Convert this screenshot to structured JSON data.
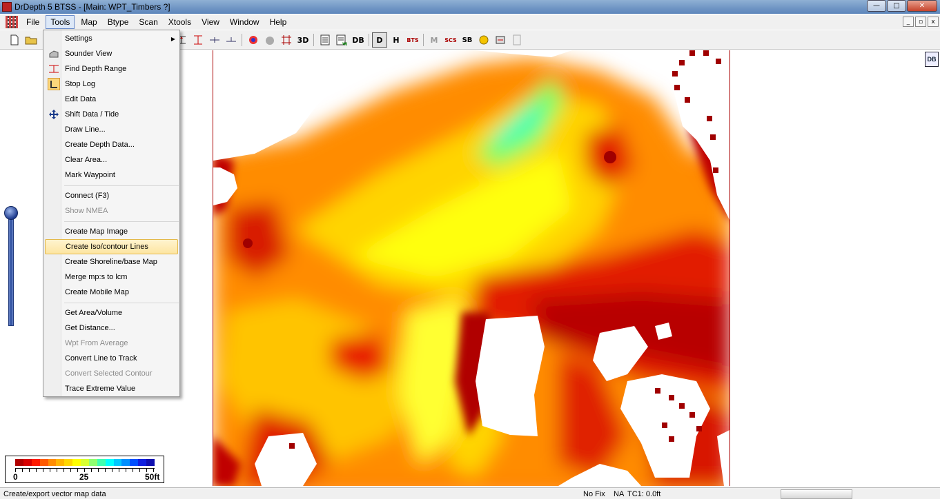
{
  "window": {
    "title": "DrDepth 5 BTSS - [Main: WPT_Timbers ?]",
    "buttons": [
      "—",
      "□",
      "✕"
    ]
  },
  "menubar": {
    "items": [
      "File",
      "Tools",
      "Map",
      "Btype",
      "Scan",
      "Xtools",
      "View",
      "Window",
      "Help"
    ],
    "active": "Tools",
    "mdi_buttons": [
      "_",
      "▫",
      "x"
    ]
  },
  "toolbar": {
    "text_buttons": {
      "three_d": "3D",
      "d_button": "D",
      "h_button": "H",
      "bts": "BTS",
      "m_button": "M",
      "scs": "SCS",
      "sb": "SB",
      "db": "DB"
    }
  },
  "tools_menu": {
    "items": [
      {
        "label": "Settings",
        "icon": "",
        "submenu": true,
        "disabled": false
      },
      {
        "label": "Sounder View",
        "icon": "sounder-icon",
        "disabled": false
      },
      {
        "label": "Find Depth Range",
        "icon": "depth-range-icon",
        "disabled": false
      },
      {
        "label": "Stop Log",
        "icon": "stop-log-icon",
        "disabled": false
      },
      {
        "label": "Edit Data",
        "icon": "",
        "disabled": false
      },
      {
        "label": "Shift Data / Tide",
        "icon": "move-arrows-icon",
        "disabled": false
      },
      {
        "label": "Draw Line...",
        "icon": "",
        "disabled": false
      },
      {
        "label": "Create Depth Data...",
        "icon": "",
        "disabled": false
      },
      {
        "label": "Clear Area...",
        "icon": "",
        "disabled": false
      },
      {
        "label": "Mark Waypoint",
        "icon": "",
        "disabled": false
      },
      {
        "label": "Connect (F3)",
        "icon": "",
        "disabled": false
      },
      {
        "label": "Show NMEA",
        "icon": "",
        "disabled": true
      },
      {
        "label": "Create Map Image",
        "icon": "",
        "disabled": false
      },
      {
        "label": "Create Iso/contour Lines",
        "icon": "",
        "disabled": false,
        "highlighted": true
      },
      {
        "label": "Create Shoreline/base Map",
        "icon": "",
        "disabled": false
      },
      {
        "label": "Merge mp:s to lcm",
        "icon": "",
        "disabled": false
      },
      {
        "label": "Create Mobile Map",
        "icon": "",
        "disabled": false
      },
      {
        "label": "Get Area/Volume",
        "icon": "",
        "disabled": false
      },
      {
        "label": "Get Distance...",
        "icon": "",
        "disabled": false
      },
      {
        "label": "Wpt From Average",
        "icon": "",
        "disabled": true
      },
      {
        "label": "Convert Line to Track",
        "icon": "",
        "disabled": false
      },
      {
        "label": "Convert Selected Contour",
        "icon": "",
        "disabled": true
      },
      {
        "label": "Trace Extreme Value",
        "icon": "",
        "disabled": false
      }
    ]
  },
  "legend": {
    "min_label": "0",
    "mid_label": "25",
    "max_label": "50ft",
    "colors": [
      "#b00000",
      "#d80000",
      "#ff1a00",
      "#ff5a00",
      "#ff8c00",
      "#ffb400",
      "#ffd700",
      "#ffff00",
      "#d8ff30",
      "#90ff70",
      "#40ffb0",
      "#00ffff",
      "#00c8ff",
      "#0090ff",
      "#0050ff",
      "#1020e0",
      "#1010b0"
    ]
  },
  "logo_text": "DB",
  "statusbar": {
    "message": "Create/export vector map data",
    "fix": "No Fix",
    "na": "NA",
    "tc1": "TC1: 0.0ft"
  }
}
